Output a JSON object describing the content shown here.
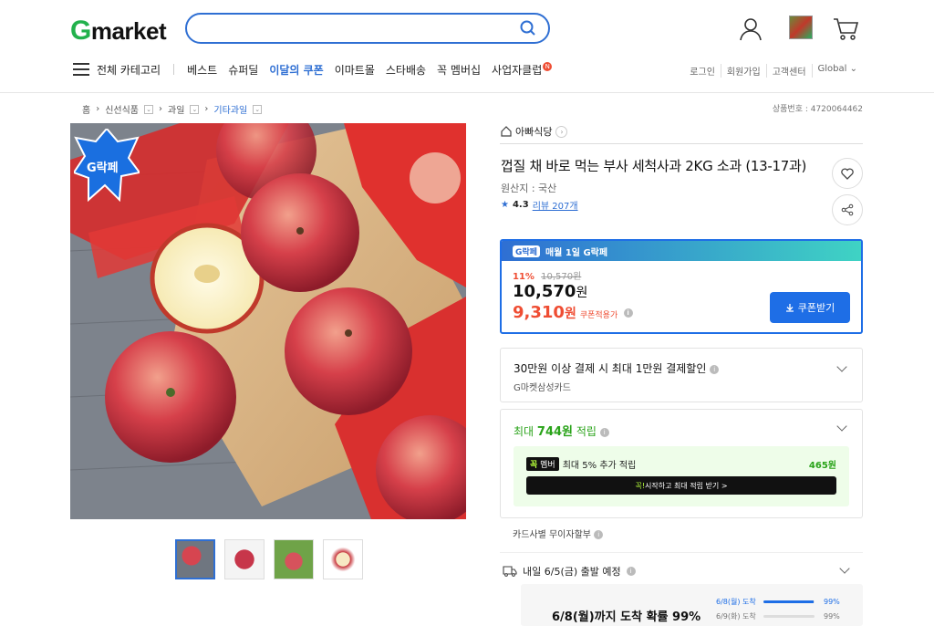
{
  "header": {
    "logo_g": "G",
    "logo_rest": "market",
    "search_placeholder": "",
    "icons": [
      "search-icon",
      "user-icon",
      "recent-item-thumb",
      "cart-icon"
    ]
  },
  "nav": {
    "all_category": "전체 카테고리",
    "items": [
      "베스트",
      "슈퍼딜",
      "이달의 쿠폰",
      "이마트몰",
      "스타배송",
      "꼭 멤버십",
      "사업자클럽"
    ],
    "highlight": "이달의 쿠폰",
    "badge": "N",
    "util": [
      "로그인",
      "회원가입",
      "고객센터",
      "Global ⌄"
    ]
  },
  "breadcrumb": {
    "items": [
      "홈",
      "신선식품",
      "과일",
      "기타과일"
    ],
    "product_no": "상품번호 : 4720064462"
  },
  "gallery": {
    "sticker": "G락페",
    "thumb_count": 4
  },
  "product": {
    "shop": "아빠식당",
    "title": "껍질 채 바로 먹는 부사 세척사과 2KG 소과 (13-17과)",
    "origin": "원산지 : 국산",
    "rating": "4.3",
    "review": "리뷰 207개"
  },
  "coupon": {
    "badge": "G락페",
    "headline": "매월 1일 G락페",
    "discount": "11%",
    "orig_price": "10,570원",
    "price": "10,570",
    "price_unit": "원",
    "final_price": "9,310",
    "final_unit": "원",
    "applied": "쿠폰적용가",
    "button": "쿠폰받기"
  },
  "card_discount": {
    "title": "30만원 이상 결제 시 최대 1만원 결제할인",
    "sub": "G마켓삼성카드"
  },
  "points": {
    "prefix": "최대 ",
    "amount": "744원",
    "suffix": " 적립",
    "member_logo_a": "꼭",
    "member_logo_b": "멤버",
    "member_text": "최대 5% 추가 적립",
    "member_amount": "465원",
    "member_btn_a": "꼭!",
    "member_btn_b": " 시작하고 최대 적립 받기 >"
  },
  "installment": "카드사별 무이자할부",
  "shipping": {
    "text": "내일 6/5(금) 출발 예정",
    "prob_text": "6/8(월)까지 도착 확률 99%",
    "rows": [
      {
        "label": "6/8(월) 도착",
        "pct": "99%",
        "value": 0.99,
        "color": "#1e6ee6"
      },
      {
        "label": "6/9(화) 도착",
        "pct": "99%",
        "value": 0.0,
        "color": "#ccc"
      }
    ]
  },
  "colors": {
    "brand_blue": "#2f6fd3",
    "price_red": "#ef4d33",
    "point_green": "#29a319"
  }
}
